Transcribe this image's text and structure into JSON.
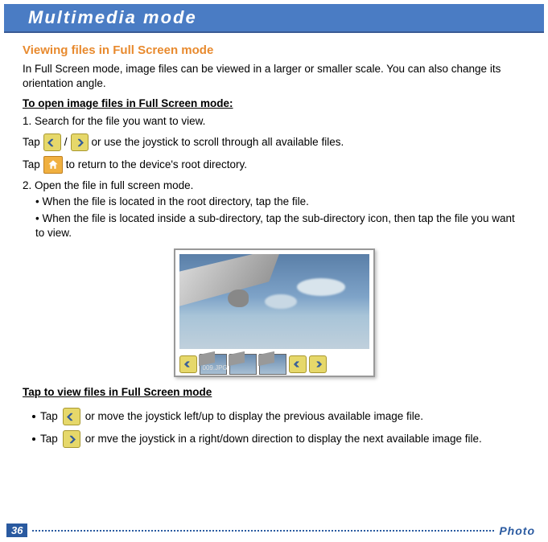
{
  "header": {
    "title": "Multimedia mode"
  },
  "section": {
    "title": "Viewing files in Full Screen mode",
    "intro": "In Full Screen mode, image files can be viewed in a larger or smaller scale. You can also change its orientation angle.",
    "open_heading": "To open image files in Full Screen mode:",
    "step1": "1. Search for the file you want to view.",
    "tap_word": "Tap",
    "slash": "/",
    "scroll_text": "or use the joystick to scroll through all available files.",
    "return_text": "to return to the device's root directory.",
    "step2": "2. Open the file in full screen mode.",
    "bullet_a": "• When the file is located in the root directory, tap the file.",
    "bullet_b": "• When the file is located inside a sub-directory, tap the sub-directory icon, then tap the file you want to view.",
    "tap_view_heading": "Tap to view files in Full Screen mode",
    "prev_text": "or move the joystick left/up to display the previous available image file.",
    "next_text": "or mve the joystick in a right/down direction to display the next available image file."
  },
  "thumb_label": "009.JPG",
  "footer": {
    "page": "36",
    "label": "Photo"
  }
}
